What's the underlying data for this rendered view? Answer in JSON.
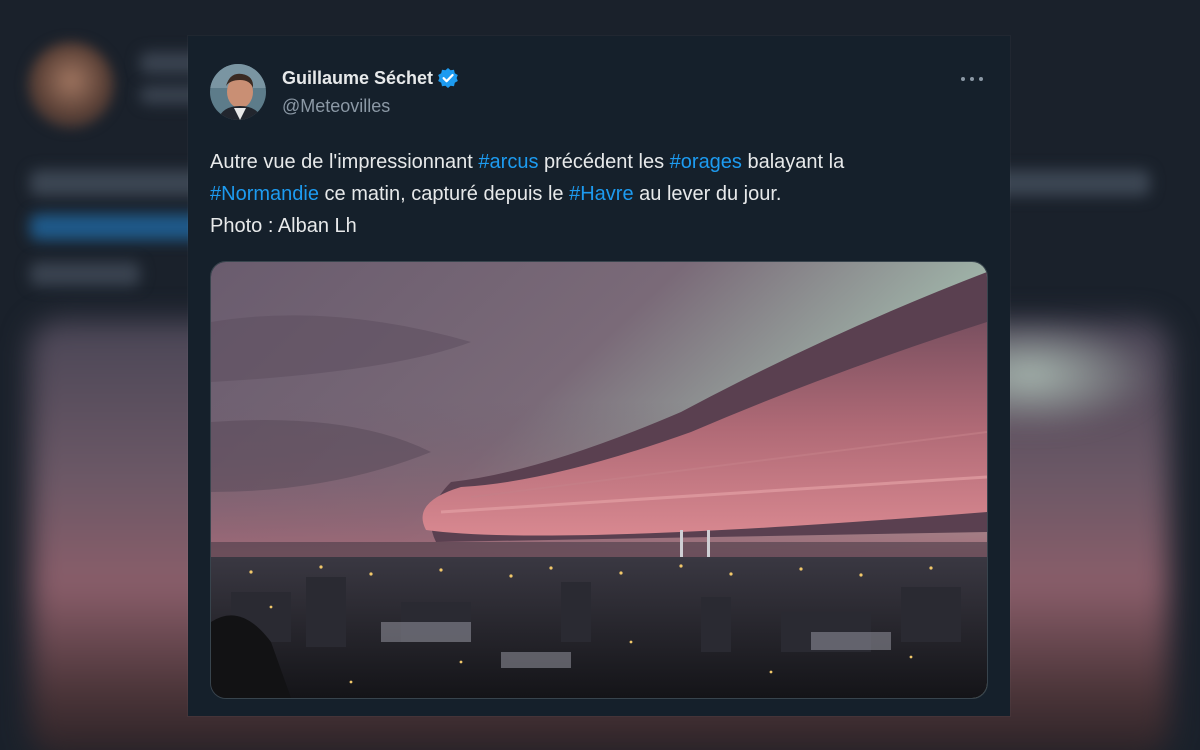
{
  "tweet": {
    "author_name": "Guillaume Séchet",
    "handle": "@Meteovilles",
    "line1_a": "Autre vue de l'impressionnant ",
    "tag_arcus": "#arcus",
    "line1_b": " précédent les ",
    "tag_orages": "#orages",
    "line1_c": " balayant la",
    "tag_normandie": "#Normandie",
    "line2_a": " ce matin, capturé depuis le ",
    "tag_havre": "#Havre",
    "line2_b": " au lever du jour.",
    "line3": "Photo : Alban Lh"
  },
  "icons": {
    "verified": "verified-badge-icon",
    "more": "more-options-icon"
  },
  "colors": {
    "background": "#15202b",
    "text": "#e7e9ea",
    "secondary": "#8b98a5",
    "link": "#1d9bf0"
  }
}
